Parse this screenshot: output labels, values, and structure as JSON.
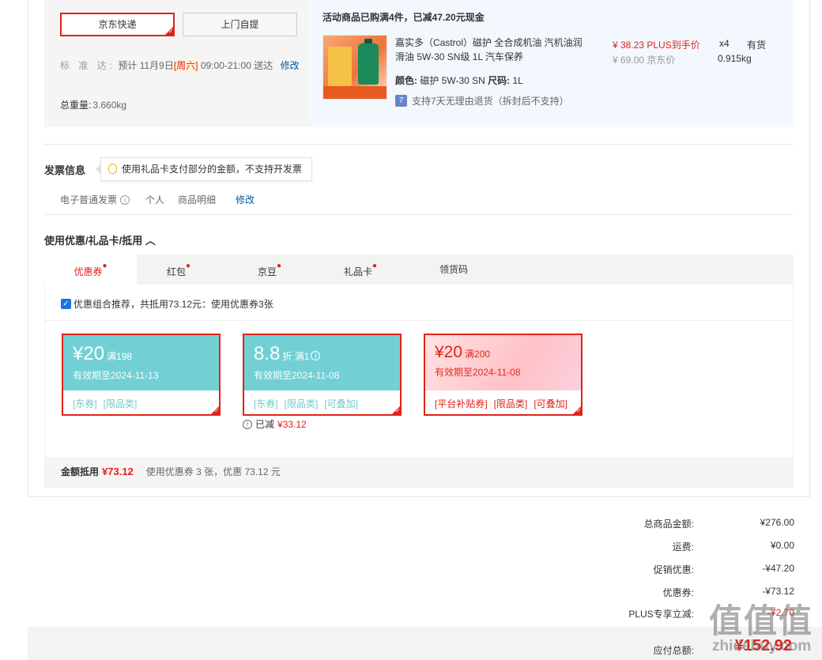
{
  "shipping": {
    "option_jd": "京东快递",
    "option_pickup": "上门自提",
    "std_label": "标 准 达:",
    "std_text_pre": "预计 11月9日",
    "std_weekday": "[周六]",
    "std_text_post": "09:00-21:00 送达",
    "modify": "修改",
    "weight_label": "总重量:",
    "weight_value": "3.660kg"
  },
  "product": {
    "promo_title": "活动商品已购满4件，已减47.20元现金",
    "name": "嘉实多（Castrol）磁护 全合成机油 汽机油润滑油 5W-30 SN级 1L 汽车保养",
    "color_label": "颜色:",
    "color_value": "磁护 5W-30 SN",
    "size_label": "尺码:",
    "size_value": "1L",
    "return_icon": "7",
    "return_text": "支持7天无理由退货（拆封后不支持）",
    "plus_price": "¥ 38.23 PLUS到手价",
    "jd_price": "¥ 69.00 京东价",
    "qty": "x4",
    "stock": "有货",
    "weight": "0.915kg"
  },
  "invoice": {
    "title": "发票信息",
    "tip": "使用礼品卡支付部分的金额，不支持开发票",
    "type": "电子普通发票",
    "person": "个人",
    "detail": "商品明细",
    "modify": "修改"
  },
  "discount": {
    "title": "使用优惠/礼品卡/抵用 ︿",
    "tabs": [
      {
        "label": "优惠券",
        "dot": "●"
      },
      {
        "label": "红包",
        "dot": "●"
      },
      {
        "label": "京豆",
        "dot": "●"
      },
      {
        "label": "礼品卡",
        "dot": "●"
      },
      {
        "label": "领货码",
        "dot": ""
      }
    ],
    "combo_text": "优惠组合推荐，共抵用73.12元：使用优惠券3张",
    "coupons": [
      {
        "amount": "¥20",
        "cond": "满198",
        "expire": "有效期至2024-11-13",
        "tags": [
          "[东券]",
          "[限品类]"
        ]
      },
      {
        "amount": "8.8",
        "cond": "折  满1",
        "expire": "有效期至2024-11-08",
        "tags": [
          "[东券]",
          "[限品类]",
          "[可叠加]"
        ]
      },
      {
        "amount": "¥20",
        "cond": "满200",
        "expire": "有效期至2024-11-08",
        "tags": [
          "[平台补贴券]",
          "[限品类]",
          "[可叠加]"
        ]
      }
    ],
    "saved_label": "已减",
    "saved_value": "¥33.12",
    "sum_label": "金额抵用",
    "sum_value": "¥73.12",
    "sum_desc": "使用优惠券 3 张，优惠 73.12 元"
  },
  "totals": {
    "rows": [
      {
        "label": "总商品金额:",
        "value": "¥276.00"
      },
      {
        "label": "运费:",
        "value": "¥0.00"
      },
      {
        "label": "促销优惠:",
        "value": "-¥47.20"
      },
      {
        "label": "优惠券:",
        "value": "-¥73.12"
      },
      {
        "label": "PLUS专享立减:",
        "value": "-¥2.70"
      }
    ],
    "pay_label": "应付总额:",
    "pay_value": "¥152.92"
  },
  "watermark": {
    "big": "值值值",
    "small": "zhidebuy.com"
  },
  "colors": {
    "accent": "#e2231a",
    "link": "#005aa0",
    "coupon_teal": "#72d0d5"
  }
}
